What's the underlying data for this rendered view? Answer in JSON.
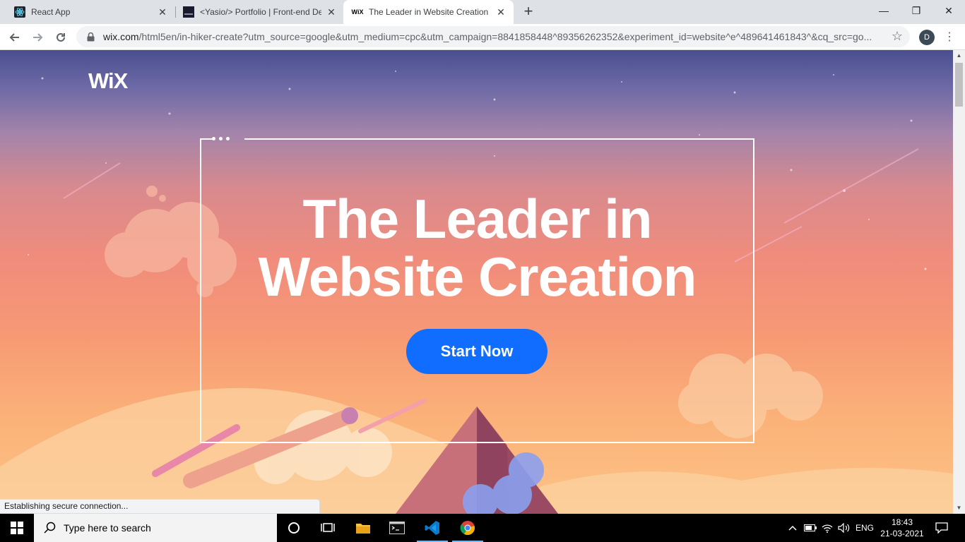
{
  "browser": {
    "tabs": [
      {
        "title": "React App",
        "close": "✕"
      },
      {
        "title": "<Yasio/> Portfolio | Front-end De",
        "close": "✕"
      },
      {
        "title": "The Leader in Website Creation |",
        "close": "✕",
        "favicon_text": "WiX"
      }
    ],
    "new_tab": "+",
    "window": {
      "minimize": "—",
      "restore": "❐",
      "close": "✕"
    },
    "url_host": "wix.com",
    "url_path": "/html5en/in-hiker-create?utm_source=google&utm_medium=cpc&utm_campaign=8841858448^89356262352&experiment_id=website^e^489641461843^&cq_src=go...",
    "profile_initial": "D"
  },
  "page": {
    "logo": "WiX",
    "headline_line1": "The Leader in",
    "headline_line2": "Website Creation",
    "cta_label": "Start Now",
    "accent_color": "#116dff"
  },
  "status": {
    "text": "Establishing secure connection..."
  },
  "taskbar": {
    "search_placeholder": "Type here to search",
    "language": "ENG",
    "time": "18:43",
    "date": "21-03-2021"
  }
}
